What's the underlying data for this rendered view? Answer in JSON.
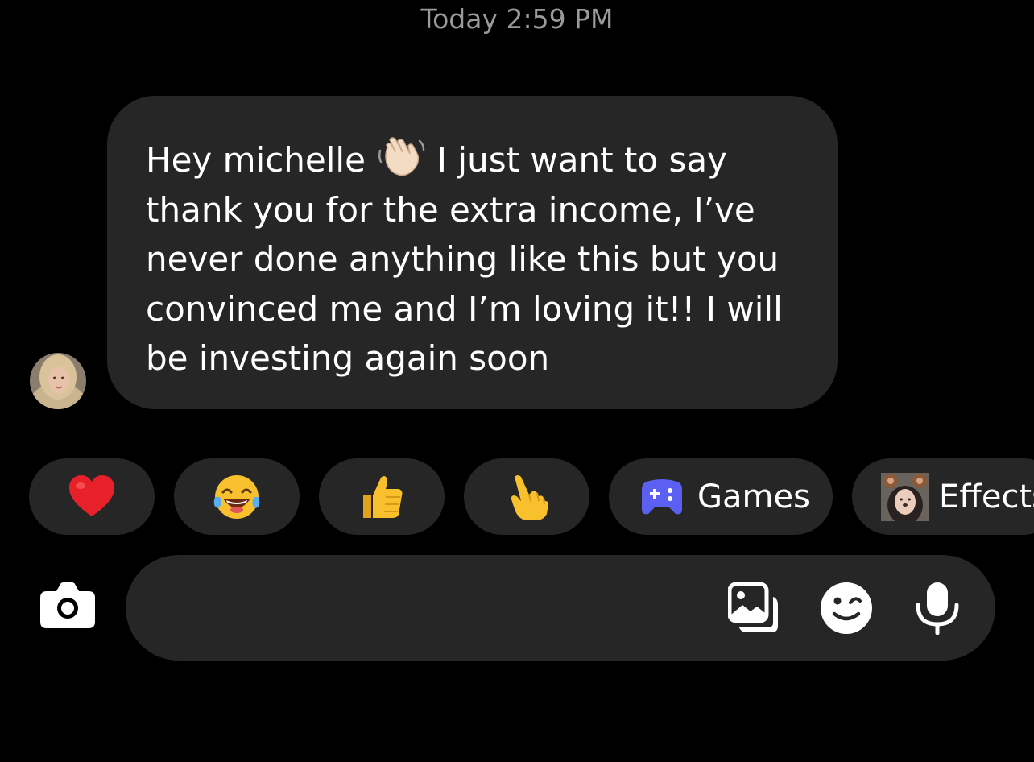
{
  "header": {
    "timestamp": "Today 2:59 PM"
  },
  "message": {
    "sender_avatar": "avatar-photo",
    "line1_before_emoji": "Hey michelle",
    "line1_emoji": "waving-hand-emoji",
    "line1_after_emoji": "I just want to say",
    "line2": "thank you for the extra income, I’ve",
    "line3": "never done anything like this but you",
    "line4": "convinced me and I’m loving it!! I will",
    "line5": "be investing again soon"
  },
  "quick_reactions": [
    {
      "icon": "red-heart-emoji"
    },
    {
      "icon": "laughing-tears-emoji"
    },
    {
      "icon": "thumbs-up-emoji"
    },
    {
      "icon": "pointing-hand-emoji"
    }
  ],
  "quick_actions": {
    "games_label": "Games",
    "games_icon": "game-controller-icon",
    "effects_label": "Effects",
    "effects_icon": "effects-thumbnail"
  },
  "composer": {
    "placeholder": "",
    "camera_icon": "camera-icon",
    "gallery_icon": "gallery-icon",
    "sticker_icon": "sticker-icon",
    "mic_icon": "microphone-icon"
  },
  "colors": {
    "background": "#000000",
    "bubble": "#262626",
    "timestamp": "#9a9a9a",
    "games_icon": "#5b5ff2",
    "text": "#ffffff"
  }
}
